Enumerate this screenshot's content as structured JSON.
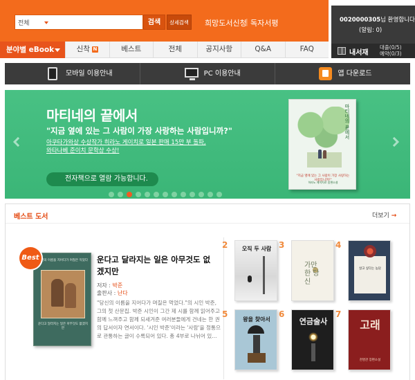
{
  "header": {
    "category_value": "전체",
    "search_placeholder": "",
    "search_label": "검색",
    "detail_search_label": "상세검색",
    "links": [
      "희망도서신청",
      "독자서평"
    ],
    "link_separator": "|"
  },
  "nav": {
    "category_menu": "분야별 eBook",
    "tabs": [
      {
        "label": "신착",
        "badge": "N"
      },
      {
        "label": "베스트"
      },
      {
        "label": "전체"
      },
      {
        "label": "공지사항"
      },
      {
        "label": "Q&A"
      },
      {
        "label": "FAQ"
      }
    ]
  },
  "user": {
    "id": "0020000305",
    "greeting_suffix": "님 환영합니다",
    "mileage": "(알림: 0)",
    "library_label": "내서재",
    "loan": "대출(0/5)",
    "reserve": "예약(0/3)"
  },
  "info_bar": [
    {
      "label": "모바일 이용안내",
      "icon": "mobile-phone-icon"
    },
    {
      "label": "PC 이용안내",
      "icon": "monitor-icon"
    },
    {
      "label": "앱 다운로드",
      "icon": "app-download-icon"
    }
  ],
  "banner": {
    "title": "마티네의 끝에서",
    "quote": "\"지금 옆에 있는 그 사람이 가장 사랑하는 사람입니까?\"",
    "desc_line1": "아쿠타가와상 수상작가 히라노 게이치로 일본 판매 15만 부 돌파,",
    "desc_line2": "와타나베 준이치 문학상 수상!",
    "button_label": "전자책으로 열람 가능합니다.",
    "cover_title": "마티네의 끝에서",
    "cover_red_text": "\"지금 옆에 있는 그 사람이 가장 사랑하는 사람입니까?\"",
    "cover_green_text": "히라노 게이치로 장편소설",
    "slide_count": 13,
    "active_slide": 2,
    "colors": {
      "bg": "#3dbd7c",
      "active_dot": "#f05a24"
    }
  },
  "best": {
    "title": "베스트 도서",
    "more_label": "더보기",
    "more_arrow": "→",
    "badge": "Best",
    "featured": {
      "title": "운다고 달라지는 일은 아무것도 없겠지만",
      "author_label": "저자 : ",
      "author": "박준",
      "publisher_label": "출판사 : ",
      "publisher": "난다",
      "description": "\"당신의 이름을 지어다가 며칠은 먹었다.\"의 시인 박준, 그의 첫 산문집. 박준 시인이 그간 제 시를 함께 읽어주고 함께 느껴주고 함께 되새겨준 여러분들에게 건네는 한 권의 답서이자 연서이다. '시인 박준'이라는 '사람'을 정통으로 관통하는 글이 수록되어 있다. 총 4부로 나뉘어 있...",
      "cover_top_text": "당신의 이름을 지어다가 며칠은 먹었다",
      "cover_sub_text": "운다고 달라지는 일은 아무것도 없겠지만"
    },
    "books": [
      {
        "rank": "2",
        "title": "오직 두 사람"
      },
      {
        "rank": "3",
        "title": "가만 한 당신"
      },
      {
        "rank": "4",
        "title": "살고 싶다는 농담"
      },
      {
        "rank": "5",
        "title": "왕을 찾아서"
      },
      {
        "rank": "6",
        "title": "연금술사"
      },
      {
        "rank": "7",
        "title": "고래",
        "subtitle": "천명관 장편소설"
      }
    ]
  }
}
